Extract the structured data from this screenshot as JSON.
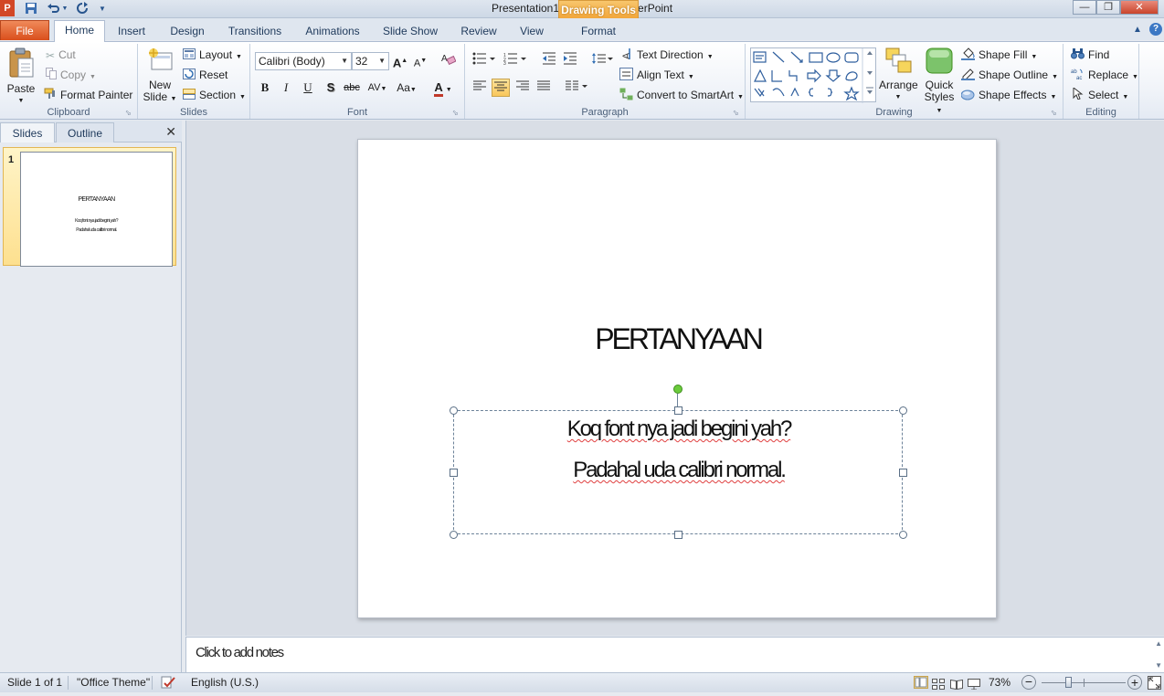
{
  "window": {
    "title": "Presentation1  -  Microsoft PowerPoint",
    "contextual_tab_group": "Drawing Tools",
    "controls": {
      "minimize": "—",
      "restore": "❐",
      "close": "✕"
    }
  },
  "quick_access": {
    "save_icon": "save-icon",
    "undo_icon": "undo-icon",
    "redo_icon": "redo-icon",
    "customize_icon": "customize-icon"
  },
  "tabs": {
    "file": "File",
    "home": "Home",
    "insert": "Insert",
    "design": "Design",
    "transitions": "Transitions",
    "animations": "Animations",
    "slide_show": "Slide Show",
    "review": "Review",
    "view": "View",
    "format": "Format"
  },
  "ribbon": {
    "clipboard": {
      "label": "Clipboard",
      "paste": "Paste",
      "cut": "Cut",
      "copy": "Copy",
      "format_painter": "Format Painter"
    },
    "slides": {
      "label": "Slides",
      "new_slide_line1": "New",
      "new_slide_line2": "Slide",
      "layout": "Layout",
      "reset": "Reset",
      "section": "Section"
    },
    "font": {
      "label": "Font",
      "font_name": "Calibri (Body)",
      "font_size": "32",
      "bold": "B",
      "italic": "I",
      "underline": "U",
      "shadow": "S",
      "strikethrough": "abc",
      "spacing": "AV",
      "change_case": "Aa",
      "font_color": "A",
      "grow": "A",
      "shrink": "A"
    },
    "paragraph": {
      "label": "Paragraph",
      "text_direction": "Text Direction",
      "align_text": "Align Text",
      "convert_smartart": "Convert to SmartArt"
    },
    "drawing": {
      "label": "Drawing",
      "arrange": "Arrange",
      "quick_styles_line1": "Quick",
      "quick_styles_line2": "Styles",
      "shape_fill": "Shape Fill",
      "shape_outline": "Shape Outline",
      "shape_effects": "Shape Effects"
    },
    "editing": {
      "label": "Editing",
      "find": "Find",
      "replace": "Replace",
      "select": "Select"
    }
  },
  "left_pane": {
    "tab_slides": "Slides",
    "tab_outline": "Outline",
    "close": "✕",
    "thumbnail_number": "1",
    "thumb_title": "PERTANYAAN",
    "thumb_line1": "Koq font nya jadi begini yah?",
    "thumb_line2": "Padahal uda calibri normal."
  },
  "slide": {
    "title": "PERTANYAAN",
    "body_line1": "Koq font nya jadi begini yah?",
    "body_line2": "Padahal uda calibri normal."
  },
  "notes": {
    "placeholder": "Click to add notes"
  },
  "status_bar": {
    "slide_info": "Slide 1 of 1",
    "theme": "\"Office Theme\"",
    "language": "English (U.S.)",
    "zoom": "73%",
    "zoom_minus": "−",
    "zoom_plus": "+"
  },
  "colors": {
    "file_tab": "#d94f1c",
    "drawing_tools": "#f2a63a",
    "rotation_handle": "#6bcb3c"
  }
}
